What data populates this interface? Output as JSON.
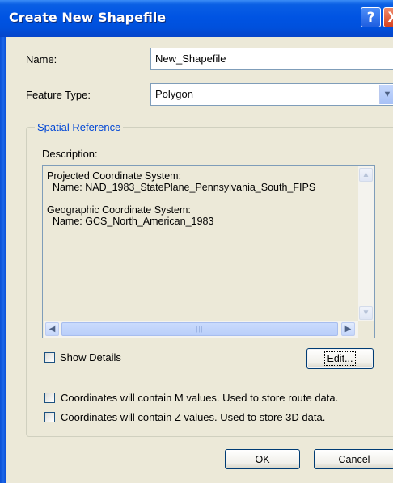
{
  "window": {
    "title": "Create New Shapefile",
    "help_glyph": "?",
    "close_glyph": "X"
  },
  "form": {
    "name_label": "Name:",
    "name_value": "New_Shapefile",
    "feature_type_label": "Feature Type:",
    "feature_type_value": "Polygon"
  },
  "spatial_reference": {
    "group_title": "Spatial Reference",
    "description_label": "Description:",
    "description_text": "Projected Coordinate System:\n  Name: NAD_1983_StatePlane_Pennsylvania_South_FIPS\n\nGeographic Coordinate System:\n  Name: GCS_North_American_1983",
    "show_details_label": "Show Details",
    "show_details_checked": false,
    "edit_button_label": "Edit..."
  },
  "options": {
    "m_values_label": "Coordinates will contain M values. Used to store route data.",
    "m_values_checked": false,
    "z_values_label": "Coordinates will contain Z values. Used to store 3D data.",
    "z_values_checked": false
  },
  "buttons": {
    "ok_label": "OK",
    "cancel_label": "Cancel"
  },
  "icons": {
    "scroll_up": "scroll-up-arrow-icon",
    "scroll_down": "scroll-down-arrow-icon",
    "scroll_left": "scroll-left-arrow-icon",
    "scroll_right": "scroll-right-arrow-icon",
    "dropdown": "chevron-down-icon"
  },
  "colors": {
    "title_bar": "#0054e3",
    "window_bg": "#ece9d8",
    "group_title": "#0046d5"
  }
}
